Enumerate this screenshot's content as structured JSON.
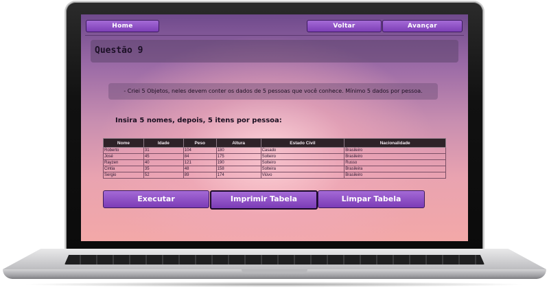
{
  "nav": {
    "home": "Home",
    "back": "Voltar",
    "forward": "Avançar"
  },
  "page": {
    "title": "Questão 9",
    "description": "- Criei 5 Objetos, neles devem conter os dados de 5 pessoas que você conhece. Mínimo 5 dados por pessoa.",
    "instruction": "Insira 5 nomes, depois, 5 itens por pessoa:"
  },
  "table": {
    "headers": [
      "Nome",
      "Idade",
      "Peso",
      "Altura",
      "Estado Civil",
      "Nacionalidade"
    ],
    "rows": [
      [
        "Roberto",
        "31",
        "104",
        "180",
        "Casado",
        "Brasileiro"
      ],
      [
        "José",
        "45",
        "84",
        "175",
        "Solteiro",
        "Brasileiro"
      ],
      [
        "Rayzen",
        "40",
        "121",
        "190",
        "Solteiro",
        "Russo"
      ],
      [
        "Cintia",
        "35",
        "48",
        "158",
        "Solteira",
        "Brasileira"
      ],
      [
        "Sergio",
        "52",
        "89",
        "174",
        "Viúvo",
        "Brasileiro"
      ]
    ]
  },
  "buttons": {
    "execute": "Executar",
    "print": "Imprimir Tabela",
    "clear": "Limpar Tabela"
  },
  "colors": {
    "button": "#8b4fc4",
    "table_header": "#2e2228"
  }
}
